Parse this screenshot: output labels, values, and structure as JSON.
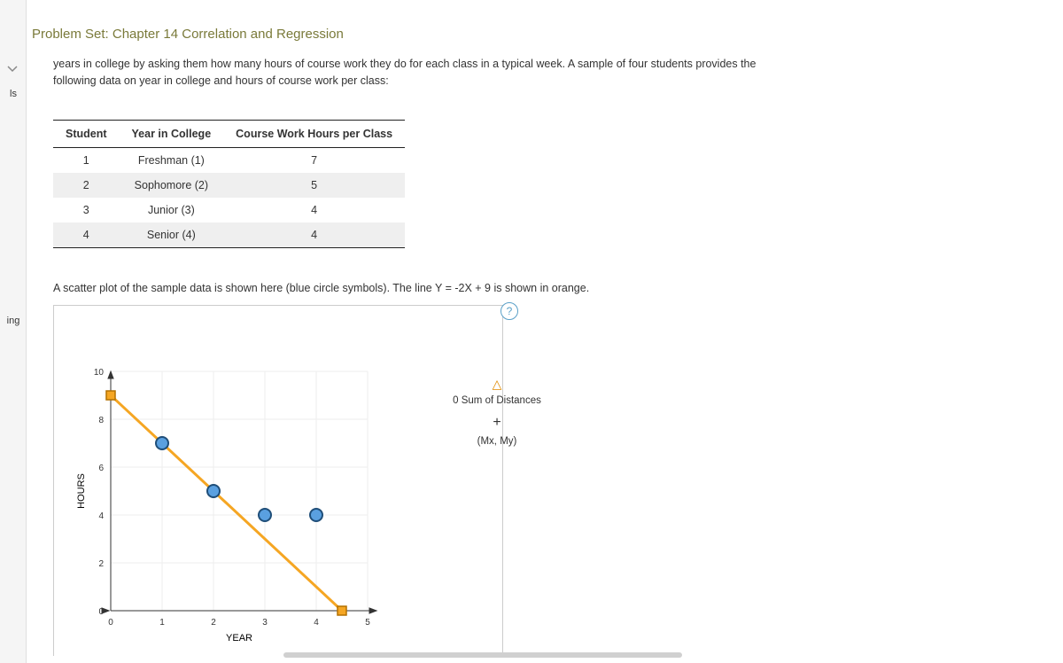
{
  "sidebar": {
    "ls_label": "ls",
    "ing_label": "ing"
  },
  "page": {
    "title": "Problem Set: Chapter 14 Correlation and Regression",
    "intro_line1": "years in college by asking them how many hours of course work they do for each class in a typical week. A sample of four students provides the",
    "intro_line2": "following data on year in college and hours of course work per class:",
    "scatter_note": "A scatter plot of the sample data is shown here (blue circle symbols). The line Y = -2X + 9 is shown in orange."
  },
  "table": {
    "headers": {
      "student": "Student",
      "year": "Year in College",
      "hours": "Course Work Hours per Class"
    },
    "rows": [
      {
        "student": "1",
        "year": "Freshman (1)",
        "hours": "7"
      },
      {
        "student": "2",
        "year": "Sophomore (2)",
        "hours": "5"
      },
      {
        "student": "3",
        "year": "Junior (3)",
        "hours": "4"
      },
      {
        "student": "4",
        "year": "Senior (4)",
        "hours": "4"
      }
    ]
  },
  "chart_data": {
    "type": "scatter",
    "xlabel": "YEAR",
    "ylabel": "HOURS",
    "xlim": [
      0,
      5
    ],
    "ylim": [
      0,
      10
    ],
    "xticks": [
      "0",
      "1",
      "2",
      "3",
      "4",
      "5"
    ],
    "yticks": [
      "0",
      "2",
      "4",
      "6",
      "8",
      "10"
    ],
    "series": [
      {
        "name": "sample-points",
        "color": "#1f78b4",
        "type": "scatter",
        "points": [
          {
            "x": 1,
            "y": 7
          },
          {
            "x": 2,
            "y": 5
          },
          {
            "x": 3,
            "y": 4
          },
          {
            "x": 4,
            "y": 4
          }
        ]
      },
      {
        "name": "line",
        "color": "#f5a623",
        "type": "line",
        "points": [
          {
            "x": 0,
            "y": 9
          },
          {
            "x": 4.5,
            "y": 0
          }
        ],
        "endpoint_marker": "square"
      }
    ],
    "legend": {
      "sum_label": "0 Sum of Distances",
      "mean_label": "(Mx, My)",
      "plus": "+"
    }
  },
  "help": {
    "badge": "?"
  }
}
